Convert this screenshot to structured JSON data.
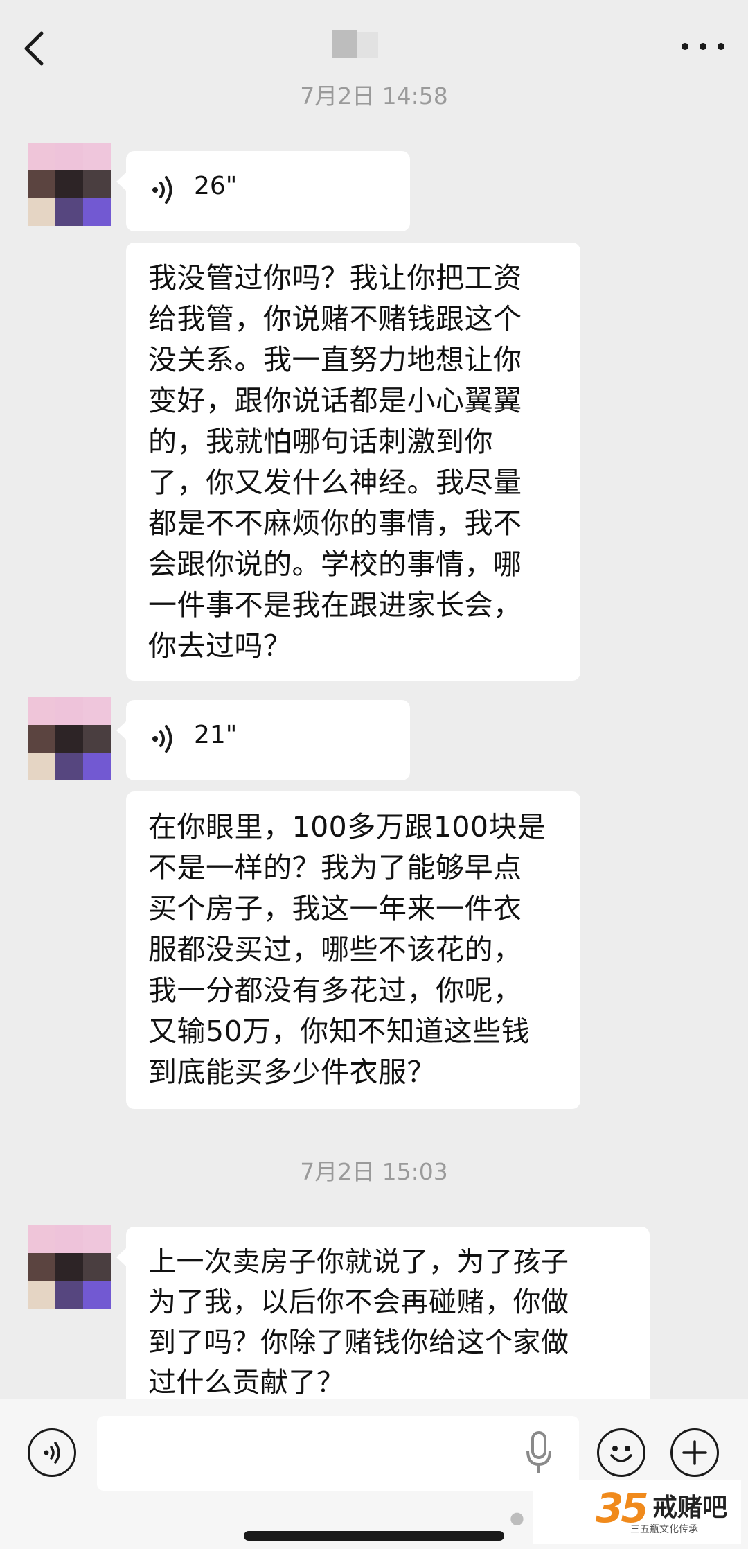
{
  "header": {
    "back_icon": "chevron-left-icon",
    "more_icon": "more-dots-icon"
  },
  "messages": [
    {
      "type": "timestamp",
      "text": "7月2日 14:58"
    },
    {
      "type": "voice",
      "duration": "26\""
    },
    {
      "type": "text",
      "text": "我没管过你吗？我让你把工资\n给我管，你说赌不赌钱跟这个\n没关系。我一直努力地想让你\n变好，跟你说话都是小心翼翼\n的，我就怕哪句话刺激到你\n了，你又发什么神经。我尽量\n都是不不麻烦你的事情，我不\n会跟你说的。学校的事情，哪\n一件事不是我在跟进家长会，\n你去过吗？"
    },
    {
      "type": "voice",
      "duration": "21\""
    },
    {
      "type": "text",
      "text": "在你眼里，100多万跟100块是\n不是一样的？我为了能够早点\n买个房子，我这一年来一件衣\n服都没买过，哪些不该花的，\n我一分都没有多花过，你呢，\n又输50万，你知不知道这些钱\n到底能买多少件衣服？"
    },
    {
      "type": "timestamp",
      "text": "7月2日 15:03"
    },
    {
      "type": "text",
      "text": "上一次卖房子你就说了，为了孩子\n为了我，以后你不会再碰赌，你做\n到了吗？你除了赌钱你给这个家做\n过什么贡献了？"
    }
  ],
  "input_bar": {
    "voice_toggle_icon": "voice-mode-icon",
    "input_value": "",
    "mic_icon": "microphone-icon",
    "emoji_icon": "emoji-icon",
    "plus_icon": "plus-icon"
  },
  "watermark": {
    "logo_number": "35",
    "name": "戒赌吧",
    "subtitle": "三五瓶文化传承"
  },
  "colors": {
    "background": "#ededed",
    "bubble": "#ffffff",
    "timestamp": "#9a9a9a",
    "avatar_pixels": [
      "#efc5d9",
      "#eec3da",
      "#efc6dc",
      "#5b4440",
      "#2d2426",
      "#4a3e40",
      "#e5d5c4",
      "#56467f",
      "#7259d2"
    ]
  }
}
